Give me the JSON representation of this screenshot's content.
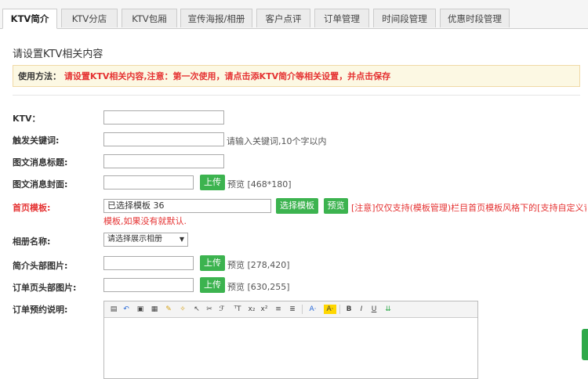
{
  "tabs": [
    "KTV简介",
    "KTV分店",
    "KTV包厢",
    "宣传海报/相册",
    "客户点评",
    "订单管理",
    "时间段管理",
    "优惠时段管理"
  ],
  "section_title": "请设置KTV相关内容",
  "tip": {
    "label": "使用方法：",
    "text": "请设置KTV相关内容,注意：第一次使用，请点击添KTV简介等相关设置，并点击保存"
  },
  "form": {
    "ktv_label": "KTV：",
    "keyword_label": "触发关键词:",
    "keyword_hint": "请输入关键词,10个字以内",
    "msg_title_label": "图文消息标题:",
    "msg_cover_label": "图文消息封面:",
    "upload": "上传",
    "cover_preview": "预览 [468*180]",
    "home_tpl_label": "首页模板:",
    "home_tpl_value": "已选择模板 36",
    "choose_tpl": "选择模板",
    "preview_btn": "预览",
    "home_tpl_note": "[注意]仅仅支持(模板管理)栏目首页模板风格下的[支持自定义背景]",
    "home_tpl_note2": "模板,如果没有就默认.",
    "album_label": "相册名称:",
    "album_select": "请选择展示相册",
    "intro_head_label": "简介头部图片:",
    "intro_head_preview": "预览 [278,420]",
    "order_head_label": "订单页头部图片:",
    "order_head_preview": "预览 [630,255]",
    "order_desc_label": "订单预约说明:"
  },
  "editor_icons": [
    "source-icon",
    "undo-icon",
    "paste-icon",
    "paste-text-icon",
    "brush-icon",
    "clear-format-icon",
    "select-all-icon",
    "cut-icon",
    "format-icon",
    "font-size-icon",
    "subscript-icon",
    "superscript-icon",
    "align-left-icon",
    "align-center-icon",
    "font-color-icon",
    "bg-color-icon",
    "bold-icon",
    "italic-icon",
    "underline-icon",
    "hr-icon"
  ],
  "colors": {
    "accent_green": "#3cb34f",
    "warn_red": "#e53333",
    "tip_bg": "#fcf8e3"
  }
}
